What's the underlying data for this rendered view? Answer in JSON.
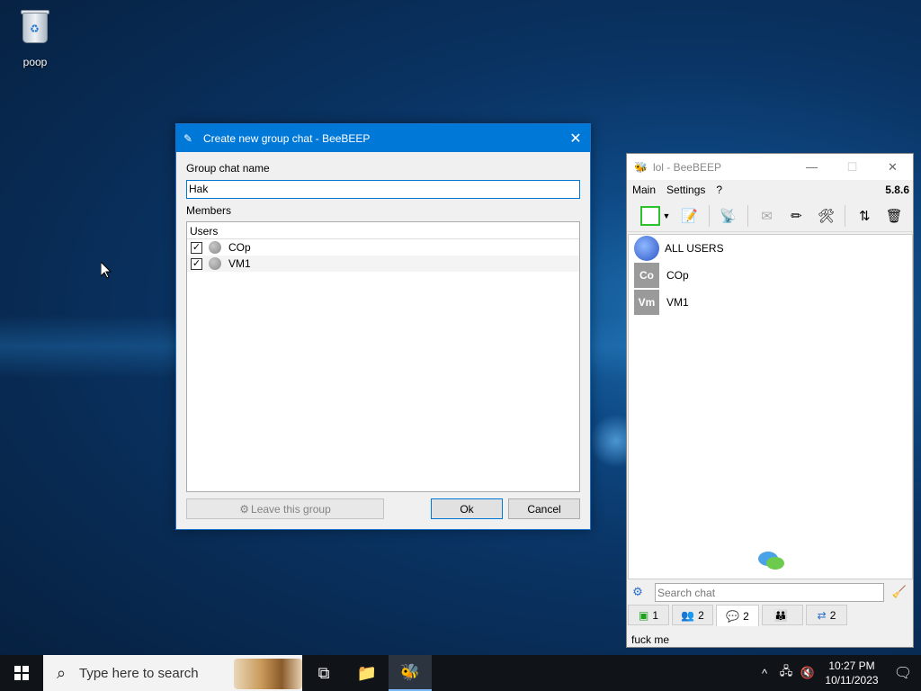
{
  "desktop": {
    "icon_label": "poop"
  },
  "dialog": {
    "title": "Create new group chat - BeeBEEP",
    "group_name_label": "Group chat name",
    "group_name_value": "Hak",
    "members_label": "Members",
    "users_header": "Users",
    "members": [
      {
        "name": "COp",
        "checked": true
      },
      {
        "name": "VM1",
        "checked": true
      }
    ],
    "leave_button": "Leave this group",
    "ok_button": "Ok",
    "cancel_button": "Cancel",
    "close_glyph": "✕"
  },
  "main_window": {
    "title": "lol - BeeBEEP",
    "menu": [
      "Main",
      "Settings",
      "?"
    ],
    "version": "5.8.6",
    "users": [
      {
        "name": "ALL USERS",
        "avatar": ""
      },
      {
        "name": "COp",
        "avatar": "Co"
      },
      {
        "name": "VM1",
        "avatar": "Vm"
      }
    ],
    "search_placeholder": "Search chat",
    "tabs": [
      {
        "icon": "monitor-icon",
        "count": "1"
      },
      {
        "icon": "users-icon",
        "count": "2"
      },
      {
        "icon": "chat-icon",
        "count": "2"
      },
      {
        "icon": "group-icon",
        "count": ""
      },
      {
        "icon": "share-icon",
        "count": "2"
      }
    ],
    "status_text": "fuck me"
  },
  "taskbar": {
    "search_placeholder": "Type here to search",
    "time": "10:27 PM",
    "date": "10/11/2023"
  },
  "colors": {
    "accent": "#0078d7",
    "taskbar": "#101418"
  }
}
